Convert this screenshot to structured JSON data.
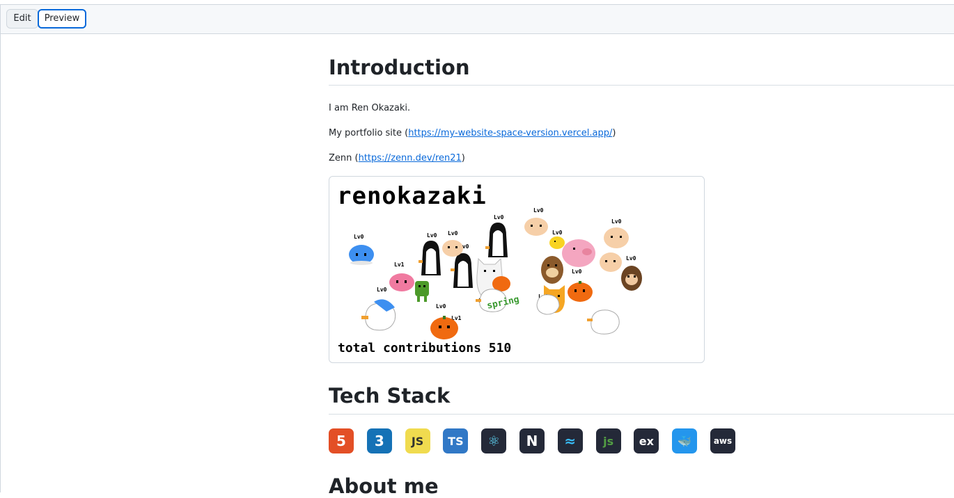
{
  "tabs": {
    "edit_label": "Edit",
    "preview_label": "Preview"
  },
  "intro": {
    "heading": "Introduction",
    "name_line": "I am Ren Okazaki.",
    "portfolio_prefix": "My portfolio site (",
    "portfolio_link": "https://my-website-space-version.vercel.app/",
    "portfolio_suffix": ")",
    "zenn_prefix": "Zenn (",
    "zenn_link": "https://zenn.dev/ren21",
    "zenn_suffix": ")"
  },
  "card": {
    "username": "renokazaki",
    "footer": "total contributions 510",
    "level_tag": "Lv0",
    "level_tag_alt": "Lv1",
    "spring_label": "spring"
  },
  "techstack": {
    "heading": "Tech Stack",
    "icons": [
      {
        "name": "html5-icon",
        "bg": "#e34f26",
        "fg": "#ffffff",
        "glyph": "5"
      },
      {
        "name": "css3-icon",
        "bg": "#1572b6",
        "fg": "#ffffff",
        "glyph": "3"
      },
      {
        "name": "javascript-icon",
        "bg": "#f0db4f",
        "fg": "#323330",
        "glyph": "JS"
      },
      {
        "name": "typescript-icon",
        "bg": "#3178c6",
        "fg": "#ffffff",
        "glyph": "TS"
      },
      {
        "name": "react-icon",
        "bg": "#242938",
        "fg": "#61dafb",
        "glyph": "⚛"
      },
      {
        "name": "nextjs-icon",
        "bg": "#242938",
        "fg": "#ffffff",
        "glyph": "N"
      },
      {
        "name": "tailwind-icon",
        "bg": "#242938",
        "fg": "#38bdf8",
        "glyph": "≈"
      },
      {
        "name": "nodejs-icon",
        "bg": "#242938",
        "fg": "#539e43",
        "glyph": "js"
      },
      {
        "name": "express-icon",
        "bg": "#242938",
        "fg": "#ffffff",
        "glyph": "ex"
      },
      {
        "name": "docker-icon",
        "bg": "#2496ed",
        "fg": "#ffffff",
        "glyph": "🐳"
      },
      {
        "name": "aws-icon",
        "bg": "#242938",
        "fg": "#ffffff",
        "glyph": "aws"
      }
    ]
  },
  "about": {
    "heading": "About me"
  }
}
